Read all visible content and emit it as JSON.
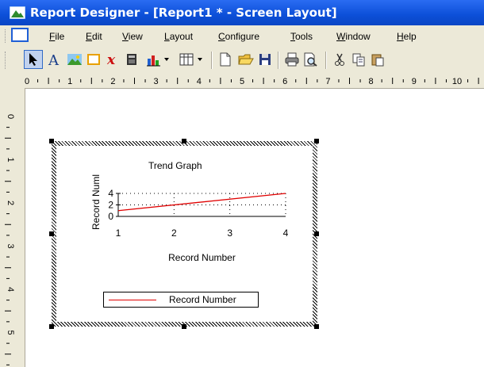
{
  "window": {
    "title": "Report Designer - [Report1 * - Screen Layout]"
  },
  "menu": [
    "File",
    "Edit",
    "View",
    "Layout",
    "Configure",
    "Tools",
    "Window",
    "Help"
  ],
  "toolbar": {
    "items": [
      "pointer-tool",
      "text-tool",
      "image-tool",
      "rectangle-tool",
      "formula-tool",
      "field-tool",
      "chart-tool",
      "table-tool",
      "new-file",
      "open-file",
      "save-file",
      "print",
      "print-preview",
      "cut",
      "copy",
      "paste"
    ]
  },
  "ruler": {
    "horizontal": [
      "0",
      "1",
      "2",
      "3",
      "4",
      "5",
      "6",
      "7",
      "8",
      "9",
      "10"
    ],
    "vertical": [
      "0",
      "1",
      "2",
      "3",
      "4",
      "5"
    ]
  },
  "chart_data": {
    "type": "line",
    "title": "Trend Graph",
    "xlabel": "Record Number",
    "ylabel": "Record Numl",
    "x": [
      1,
      2,
      3,
      4
    ],
    "x_ticks": [
      "1",
      "2",
      "3",
      "4"
    ],
    "y_ticks": [
      "4",
      "2",
      "0"
    ],
    "ylim": [
      0,
      4
    ],
    "grid": true,
    "series": [
      {
        "name": "Record Number",
        "x": [
          1,
          4
        ],
        "y": [
          1,
          4
        ],
        "color": "#e00000"
      }
    ],
    "legend": "bottom"
  }
}
